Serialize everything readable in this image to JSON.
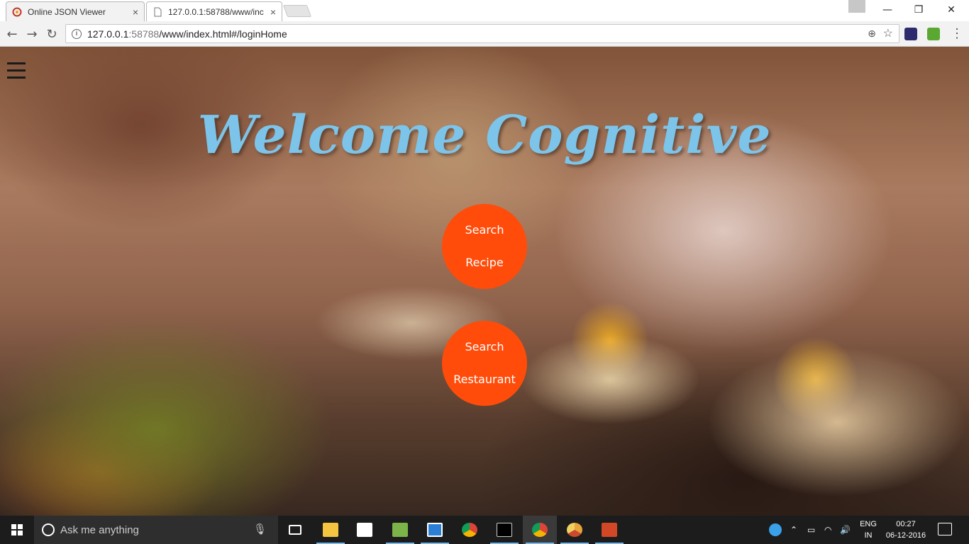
{
  "browser": {
    "tabs": [
      {
        "title": "Online JSON Viewer",
        "close": "×"
      },
      {
        "title": "127.0.0.1:58788/www/inc",
        "close": "×"
      }
    ],
    "window_controls": {
      "minimize": "—",
      "restore": "❐",
      "close": "✕"
    },
    "nav": {
      "back": "←",
      "forward": "→",
      "reload": "↻"
    },
    "address": {
      "host": "127.0.0.1",
      "port": ":58788",
      "path": "/www/index.html#/loginHome"
    },
    "omnibox_icons": {
      "zoom": "⊕",
      "star": "☆"
    },
    "menu": "⋮"
  },
  "page": {
    "heading": "Welcome Cognitive",
    "buttons": [
      {
        "line1": "Search",
        "line2": "Recipe"
      },
      {
        "line1": "Search",
        "line2": "Restaurant"
      }
    ]
  },
  "taskbar": {
    "search_placeholder": "Ask me anything",
    "mic": "🎙",
    "tray": {
      "chevron": "⌃",
      "battery": "▭",
      "wifi": "◠",
      "volume": "🔊"
    },
    "language": {
      "line1": "ENG",
      "line2": "IN"
    },
    "clock": {
      "time": "00:27",
      "date": "06-12-2016"
    }
  },
  "colors": {
    "accent_button": "#ff4c0a",
    "heading": "#7cc4ea",
    "taskbar": "#1c1c1c"
  }
}
